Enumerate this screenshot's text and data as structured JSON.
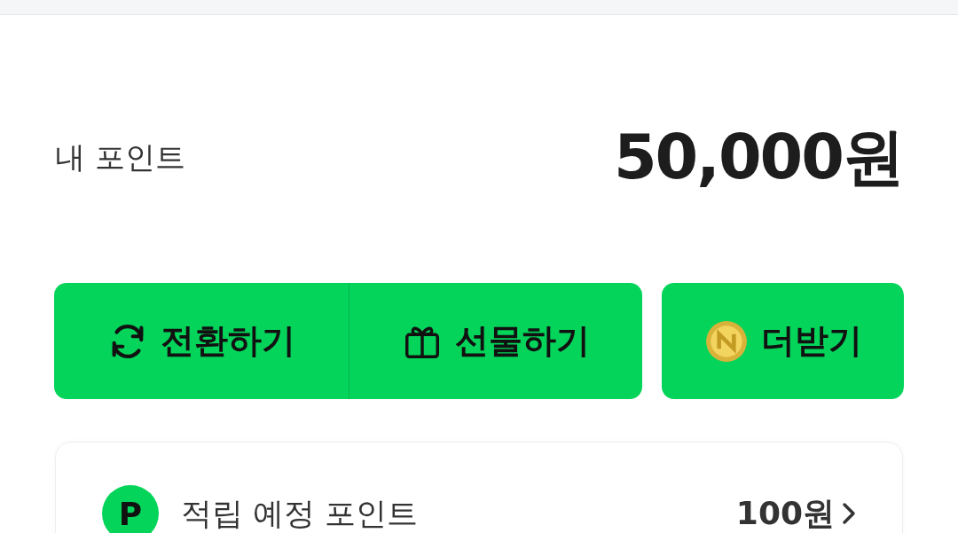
{
  "points": {
    "label": "내 포인트",
    "amount": "50,000원"
  },
  "actions": [
    {
      "label": "전환하기",
      "kind": "convert"
    },
    {
      "label": "선물하기",
      "kind": "gift"
    },
    {
      "label": "더받기",
      "kind": "coin"
    }
  ],
  "pending": {
    "badge": "P",
    "label": "적립 예정 포인트",
    "amount": "100원"
  }
}
